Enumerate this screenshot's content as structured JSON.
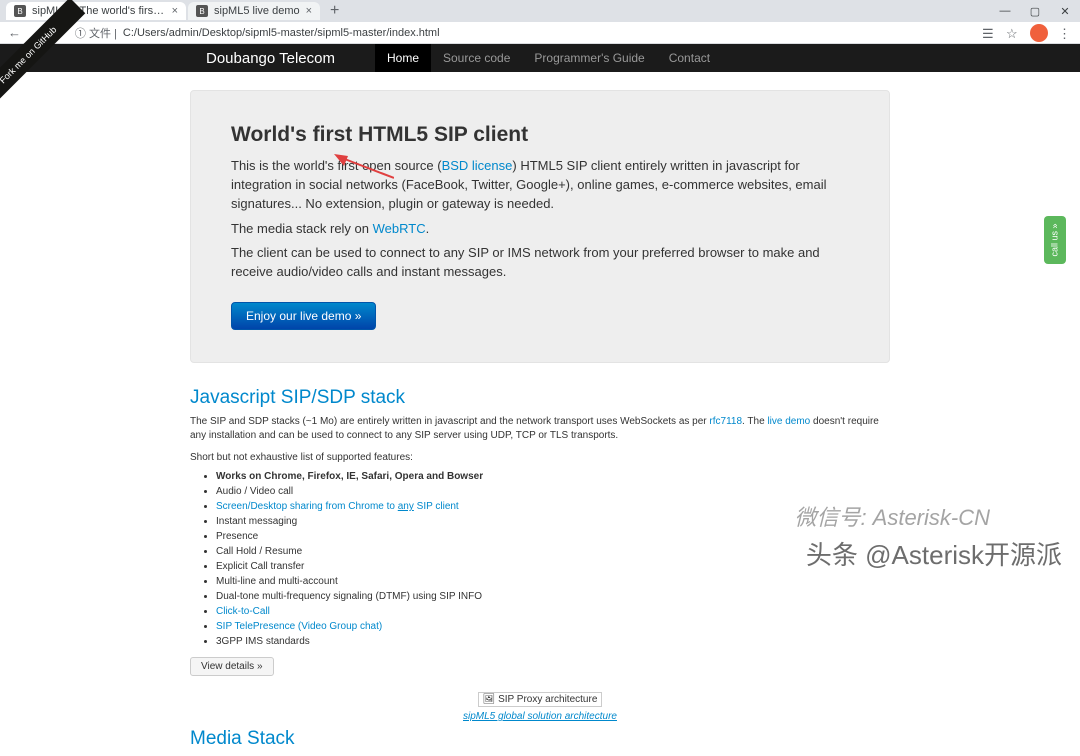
{
  "browser": {
    "tabs": [
      {
        "title": "sipML5 – The world's first op…"
      },
      {
        "title": "sipML5 live demo"
      }
    ],
    "url_prefix": "① 文件 |",
    "url": "C:/Users/admin/Desktop/sipml5-master/sipml5-master/index.html"
  },
  "nav": {
    "brand": "Doubango Telecom",
    "links": [
      "Home",
      "Source code",
      "Programmer's Guide",
      "Contact"
    ]
  },
  "ribbon": "Fork me on GitHub",
  "hero": {
    "title": "World's first HTML5 SIP client",
    "p1a": "This is the world's first open source (",
    "p1link": "BSD license",
    "p1b": ") HTML5 SIP client entirely written in javascript for integration in social networks (FaceBook, Twitter, Google+), online games, e-commerce websites, email signatures... No extension, plugin or gateway is needed.",
    "p2a": "The media stack rely on ",
    "p2link": "WebRTC",
    "p2b": ".",
    "p3": "The client can be used to connect to any SIP or IMS network from your preferred browser to make and receive audio/video calls and instant messages.",
    "button": "Enjoy our live demo »"
  },
  "stack": {
    "heading": "Javascript SIP/SDP stack",
    "p1a": "The SIP and SDP stacks (~1 Mo) are entirely written in javascript and the network transport uses WebSockets as per ",
    "p1link1": "rfc7118",
    "p1mid": ". The ",
    "p1link2": "live demo",
    "p1b": " doesn't require any installation and can be used to connect to any SIP server using UDP, TCP or TLS transports.",
    "p2": "Short but not exhaustive list of supported features:",
    "features": [
      {
        "text": "Works on Chrome, Firefox, IE, Safari, Opera and Bowser",
        "bold": true
      },
      {
        "text": "Audio / Video call"
      },
      {
        "html": true,
        "parts": [
          "Screen/Desktop sharing from Chrome to ",
          "any",
          " SIP client"
        ]
      },
      {
        "text": "Instant messaging"
      },
      {
        "text": "Presence"
      },
      {
        "text": "Call Hold / Resume"
      },
      {
        "text": "Explicit Call transfer"
      },
      {
        "text": "Multi-line and multi-account"
      },
      {
        "text": "Dual-tone multi-frequency signaling (DTMF) using SIP INFO"
      },
      {
        "link": true,
        "text": "Click-to-Call"
      },
      {
        "link": true,
        "text": "SIP TelePresence (Video Group chat)"
      },
      {
        "text": "3GPP IMS standards"
      }
    ],
    "details_btn": "View details »"
  },
  "arch": {
    "alt": "SIP Proxy architecture",
    "caption": "sipML5 global solution architecture"
  },
  "media_heading": "Media Stack",
  "callus": "call us »",
  "watermarks": {
    "w1": "微信号: Asterisk-CN",
    "w2": "头条 @Asterisk开源派"
  }
}
